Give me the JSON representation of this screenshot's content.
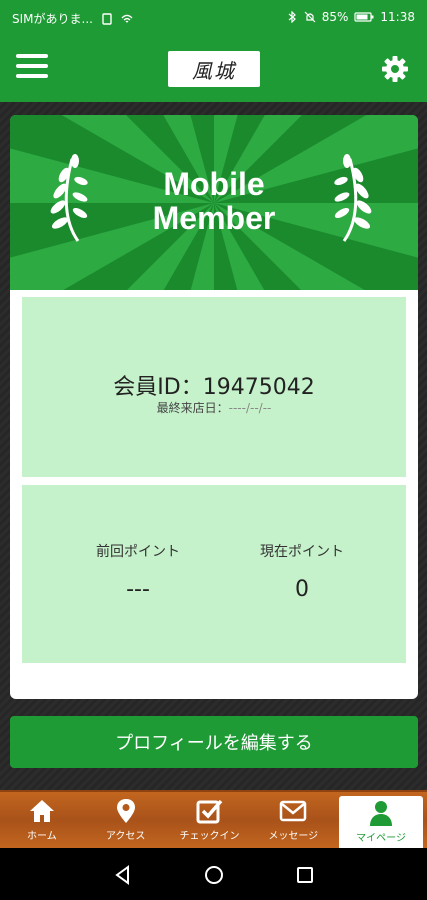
{
  "status_bar": {
    "carrier": "SIMがありま...",
    "battery": "85%",
    "time": "11:38"
  },
  "header": {
    "logo_text": "風城",
    "menu_icon": "hamburger-menu-icon",
    "settings_icon": "gear-icon"
  },
  "banner": {
    "title_line1": "Mobile",
    "title_line2": "Member"
  },
  "member": {
    "id_label": "会員ID：19475042",
    "last_visit_label": "最終来店日：",
    "last_visit_value": "----/--/--"
  },
  "points": {
    "prev_label": "前回ポイント",
    "prev_value": "---",
    "curr_label": "現在ポイント",
    "curr_value": "0"
  },
  "edit_button": {
    "label": "プロフィールを編集する"
  },
  "tabs": [
    {
      "label": "ホーム",
      "icon": "home-icon",
      "active": false
    },
    {
      "label": "アクセス",
      "icon": "map-pin-icon",
      "active": false
    },
    {
      "label": "チェックイン",
      "icon": "checkin-icon",
      "active": false
    },
    {
      "label": "メッセージ",
      "icon": "envelope-icon",
      "active": false
    },
    {
      "label": "マイページ",
      "icon": "person-icon",
      "active": true
    }
  ],
  "colors": {
    "primary_green": "#1f9b35",
    "panel_green": "#c6f2cb",
    "tab_wood": "#b45a1c"
  }
}
